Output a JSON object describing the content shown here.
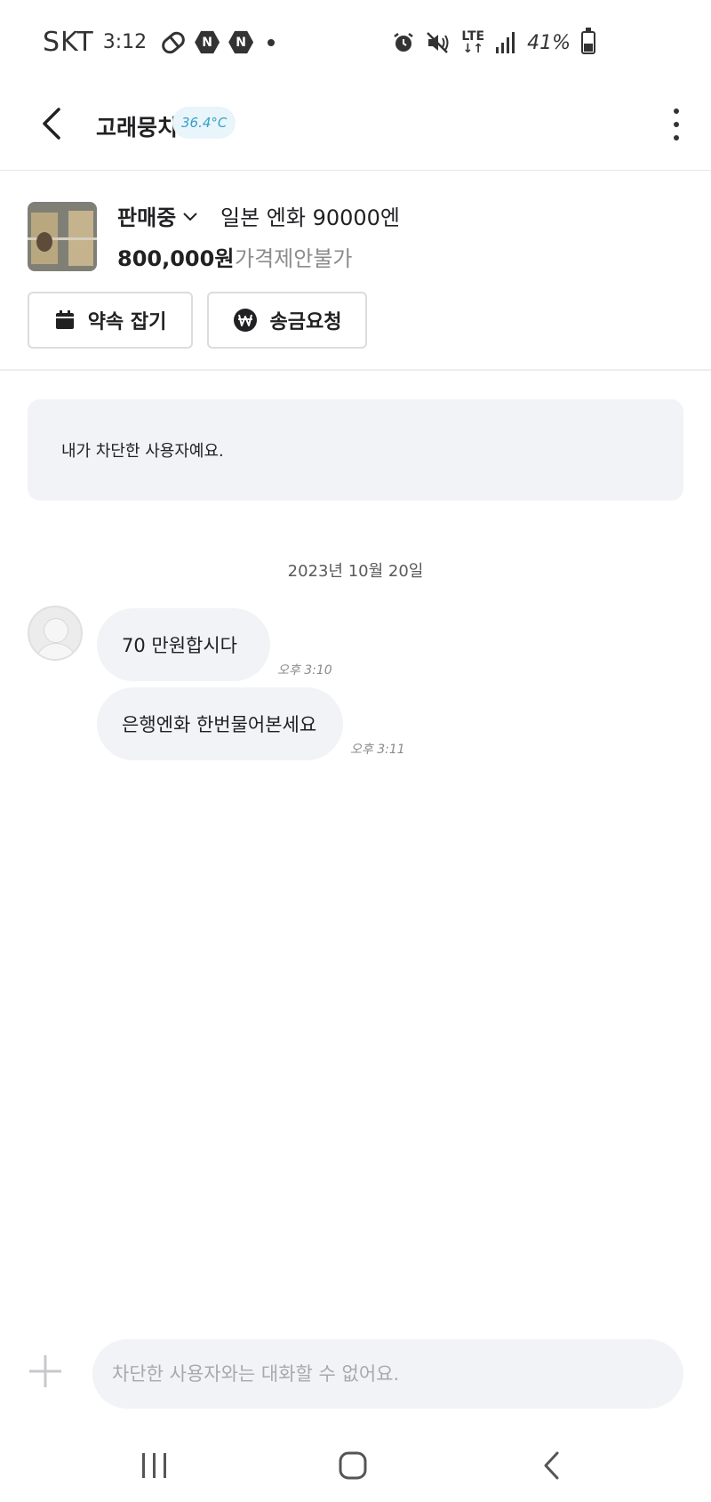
{
  "status_bar": {
    "carrier": "SKT",
    "time": "3:12",
    "battery_text": "41%",
    "battery_level": 0.41,
    "network": "LTE",
    "icons": [
      "pill-icon",
      "naver-icon",
      "naver-icon",
      "notification-dot-icon",
      "alarm-icon",
      "mute-icon",
      "lte-icon",
      "signal-icon",
      "battery-icon"
    ]
  },
  "header": {
    "title": "고래뭉치",
    "temperature": "36.4°C",
    "icons": {
      "back": "chevron-left-icon",
      "more": "more-vertical-icon"
    }
  },
  "product": {
    "status": "판매중",
    "title": "일본 엔화 90000엔",
    "price": "800,000원",
    "offer_note": "가격제안불가",
    "actions": {
      "appointment_label": "약속 잡기",
      "transfer_label": "송금요청"
    }
  },
  "chat": {
    "blocked_notice": "내가 차단한 사용자예요.",
    "date": "2023년 10월 20일",
    "messages": [
      {
        "text": "70 만원합시다",
        "time": "오후 3:10"
      },
      {
        "text": "은행엔화 한번물어본세요",
        "time": "오후 3:11"
      }
    ]
  },
  "input": {
    "placeholder": "차단한 사용자와는 대화할 수 없어요."
  },
  "colors": {
    "bubble_bg": "#f2f3f6",
    "temp_text": "#3a9fc8",
    "temp_bg": "#e8f5fb",
    "muted_text": "#8b8b8b"
  }
}
